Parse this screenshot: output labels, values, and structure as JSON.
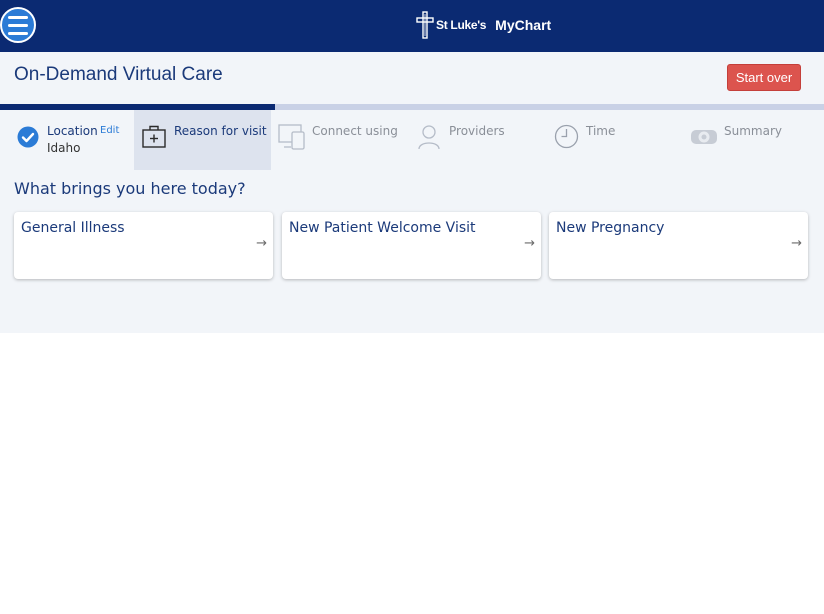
{
  "brand": {
    "org_name": "St Luke's",
    "app_name": "MyChart",
    "nav_color": "#0b2a72",
    "accent_color": "#2b7bd6",
    "danger_color": "#dc544e"
  },
  "header": {
    "title": "On-Demand Virtual Care",
    "start_over_label": "Start over"
  },
  "progress": {
    "completed_steps": 2,
    "total_steps": 6
  },
  "steps": [
    {
      "label": "Location",
      "value": "Idaho",
      "edit_label": "Edit",
      "icon": "check-circle-icon",
      "state": "complete"
    },
    {
      "label": "Reason for visit",
      "icon": "medical-kit-icon",
      "state": "active"
    },
    {
      "label": "Connect using",
      "icon": "computer-icon",
      "state": "pending"
    },
    {
      "label": "Providers",
      "icon": "person-icon",
      "state": "pending"
    },
    {
      "label": "Time",
      "icon": "clock-icon",
      "state": "pending"
    },
    {
      "label": "Summary",
      "icon": "video-icon",
      "state": "pending"
    }
  ],
  "question": "What brings you here today?",
  "reasons": [
    {
      "label": "New Patient Welcome Visit"
    },
    {
      "label": "New Pregnancy"
    }
  ],
  "reason_cards": {
    "first": "General Illness",
    "second": "New Patient Welcome Visit",
    "third": "New Pregnancy",
    "arrow_icon": "arrow-right-icon"
  }
}
